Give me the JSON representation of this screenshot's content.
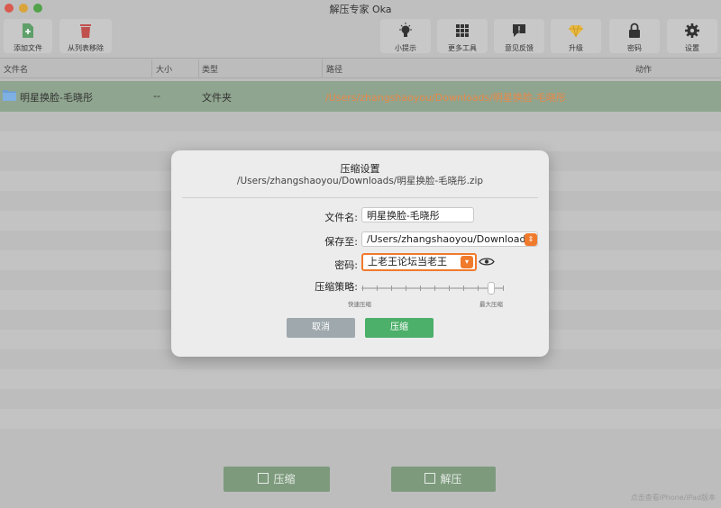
{
  "window": {
    "title": "解压专家 Oka"
  },
  "toolbar": {
    "add_file": "添加文件",
    "remove_from_list": "从列表移除",
    "tips": "小提示",
    "more_tools": "更多工具",
    "feedback": "意见反馈",
    "upgrade": "升级",
    "password": "密码",
    "settings": "设置"
  },
  "table": {
    "headers": {
      "name": "文件名",
      "size": "大小",
      "type": "类型",
      "path": "路径",
      "action": "动作"
    },
    "rows": [
      {
        "name": "明星换脸-毛晓彤",
        "size": "--",
        "type": "文件夹",
        "path": "/Users/zhangshaoyou/Downloads/明星换脸-毛晓彤"
      }
    ]
  },
  "dialog": {
    "title": "压缩设置",
    "subtitle": "/Users/zhangshaoyou/Downloads/明星换脸-毛晓彤.zip",
    "filename_label": "文件名:",
    "filename_value": "明星换脸-毛晓彤",
    "save_to_label": "保存至:",
    "save_to_value": "/Users/zhangshaoyou/Downloads",
    "password_label": "密码:",
    "password_value": "上老王论坛当老王",
    "strategy_label": "压缩策略:",
    "fast_label": "快速压缩",
    "max_label": "最大压缩",
    "compression_level": 1.0,
    "cancel": "取消",
    "compress": "压缩"
  },
  "bottom": {
    "compress": "压缩",
    "extract": "解压",
    "footnote": "点击查看iPhone/iPad版本"
  },
  "colors": {
    "accent_green": "#4caf6a",
    "orange": "#f07a2c",
    "path_orange": "#e8894a"
  }
}
